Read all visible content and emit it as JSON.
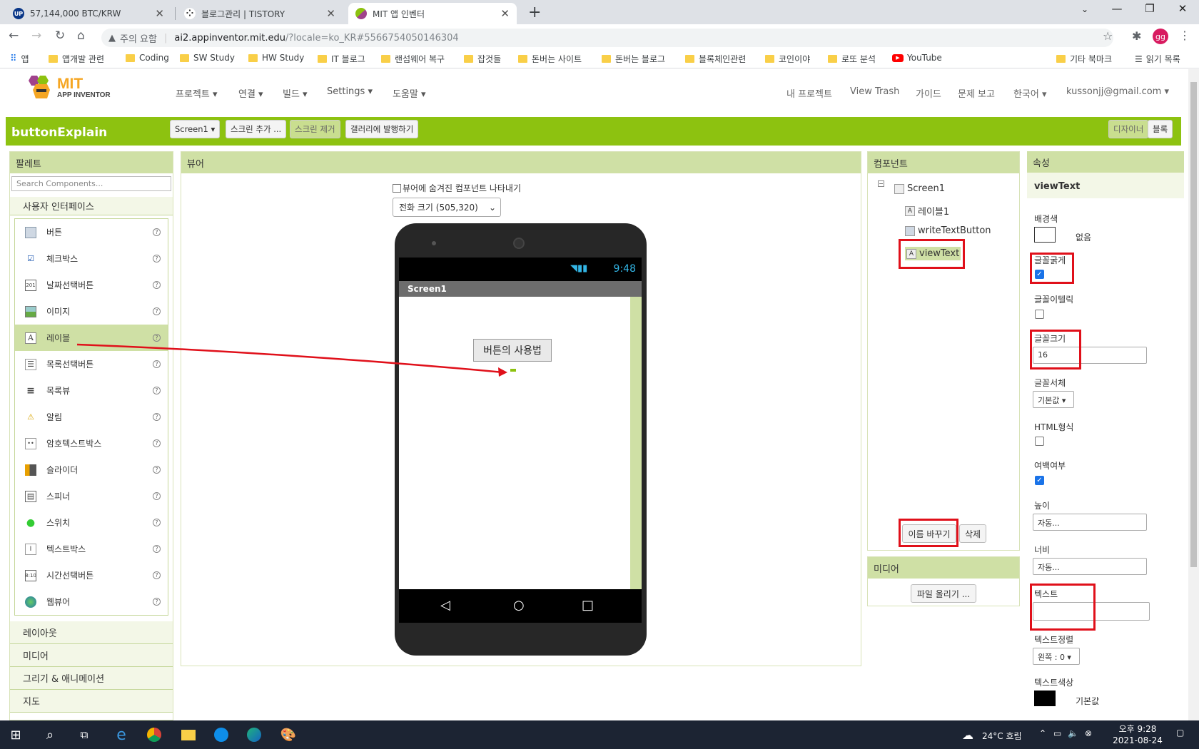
{
  "browser": {
    "tabs": [
      {
        "title": "57,144,000 BTC/KRW",
        "icon": "upbit-icon",
        "favicon_text": "UP",
        "color": "#093687"
      },
      {
        "title": "블로그관리 | TISTORY",
        "icon": "tistory-icon",
        "color": "#333333"
      },
      {
        "title": "MIT 앱 인벤터",
        "icon": "app-inventor-icon",
        "color": "#8dc210"
      }
    ],
    "security_label": "주의 요함",
    "url_domain": "ai2.appinventor.mit.edu",
    "url_path": "/?locale=ko_KR#5566754050146304",
    "profile_initials": "gg",
    "bookmarks": [
      {
        "label": "앱",
        "icon": "apps-grid-icon"
      },
      {
        "label": "앱개발 관련"
      },
      {
        "label": "Coding"
      },
      {
        "label": "SW Study"
      },
      {
        "label": "HW Study"
      },
      {
        "label": "IT 블로그"
      },
      {
        "label": "랜섬웨어 복구"
      },
      {
        "label": "잡것들"
      },
      {
        "label": "돈버는 사이트"
      },
      {
        "label": "돈버는 블로그"
      },
      {
        "label": "블록체인관련"
      },
      {
        "label": "코인이야"
      },
      {
        "label": "로또 분석"
      },
      {
        "label": "YouTube",
        "icon": "youtube-icon"
      }
    ],
    "bookmarks_right": [
      {
        "label": "기타 북마크"
      },
      {
        "label": "읽기 목록",
        "icon": "reading-list-icon"
      }
    ]
  },
  "app": {
    "logo_mit": "MIT",
    "logo_sub": "APP INVENTOR",
    "menu": [
      "프로젝트 ▾",
      "연결 ▾",
      "빌드 ▾",
      "Settings ▾",
      "도움말 ▾"
    ],
    "right_menu": [
      "내 프로젝트",
      "View Trash",
      "가이드",
      "문제 보고",
      "한국어 ▾",
      "kussonjj@gmail.com ▾"
    ],
    "project_name": "buttonExplain",
    "screen_select": "Screen1 ▾",
    "add_screen": "스크린 추가 ...",
    "remove_screen": "스크린 제거",
    "publish_gallery": "갤러리에 발행하기",
    "designer_btn": "디자이너",
    "blocks_btn": "블록"
  },
  "palette": {
    "title": "팔레트",
    "search_placeholder": "Search Components...",
    "category_open": "사용자 인터페이스",
    "items": [
      {
        "label": "버튼",
        "icon": "button-icon"
      },
      {
        "label": "체크박스",
        "icon": "checkbox-icon"
      },
      {
        "label": "날짜선택버튼",
        "icon": "datepicker-icon"
      },
      {
        "label": "이미지",
        "icon": "image-icon"
      },
      {
        "label": "레이블",
        "icon": "label-icon"
      },
      {
        "label": "목록선택버튼",
        "icon": "listpicker-icon"
      },
      {
        "label": "목록뷰",
        "icon": "listview-icon"
      },
      {
        "label": "알림",
        "icon": "notifier-icon"
      },
      {
        "label": "암호텍스트박스",
        "icon": "passwordtextbox-icon"
      },
      {
        "label": "슬라이더",
        "icon": "slider-icon"
      },
      {
        "label": "스피너",
        "icon": "spinner-icon"
      },
      {
        "label": "스위치",
        "icon": "switch-icon"
      },
      {
        "label": "텍스트박스",
        "icon": "textbox-icon"
      },
      {
        "label": "시간선택버튼",
        "icon": "timepicker-icon"
      },
      {
        "label": "웹뷰어",
        "icon": "webviewer-icon"
      }
    ],
    "selected_index": 4,
    "categories": [
      "레이아웃",
      "미디어",
      "그리기 & 애니메이션",
      "지도"
    ]
  },
  "viewer": {
    "title": "뷰어",
    "hidden_checkbox_label": "뷰어에 숨겨진 컴포넌트 나타내기",
    "size_select": "전화 크기 (505,320)",
    "status_time": "9:48",
    "screen_title": "Screen1",
    "button_text": "버튼의 사용법"
  },
  "components": {
    "title": "컴포넌트",
    "tree_root": "Screen1",
    "children": [
      "레이블1",
      "writeTextButton",
      "viewText"
    ],
    "selected": "viewText",
    "rename_btn": "이름 바꾸기",
    "delete_btn": "삭제"
  },
  "media": {
    "title": "미디어",
    "upload_btn": "파일 올리기 ..."
  },
  "properties": {
    "title": "속성",
    "component_name": "viewText",
    "bgcolor_label": "배경색",
    "bgcolor_value": "없음",
    "fontbold_label": "글꼴굵게",
    "fontbold_checked": true,
    "fontitalic_label": "글꼴이텔릭",
    "fontitalic_checked": false,
    "fontsize_label": "글꼴크기",
    "fontsize_value": "16",
    "typeface_label": "글꼴서체",
    "typeface_value": "기본값 ▾",
    "html_label": "HTML형식",
    "html_checked": false,
    "margin_label": "여백여부",
    "margin_checked": true,
    "height_label": "높이",
    "height_value": "자동...",
    "width_label": "너비",
    "width_value": "자동...",
    "text_label": "텍스트",
    "text_value": "",
    "textalign_label": "텍스트정렬",
    "textalign_value": "왼쪽 : 0 ▾",
    "textcolor_label": "텍스트색상",
    "textcolor_value": "기본값"
  },
  "taskbar": {
    "weather": "24°C 흐림",
    "time": "오후 9:28",
    "date": "2021-08-24"
  },
  "colors": {
    "accent_green": "#8dc210",
    "panel_header": "#cfe0a5",
    "highlight_red": "#e0101a",
    "taskbar": "#1c2433"
  }
}
